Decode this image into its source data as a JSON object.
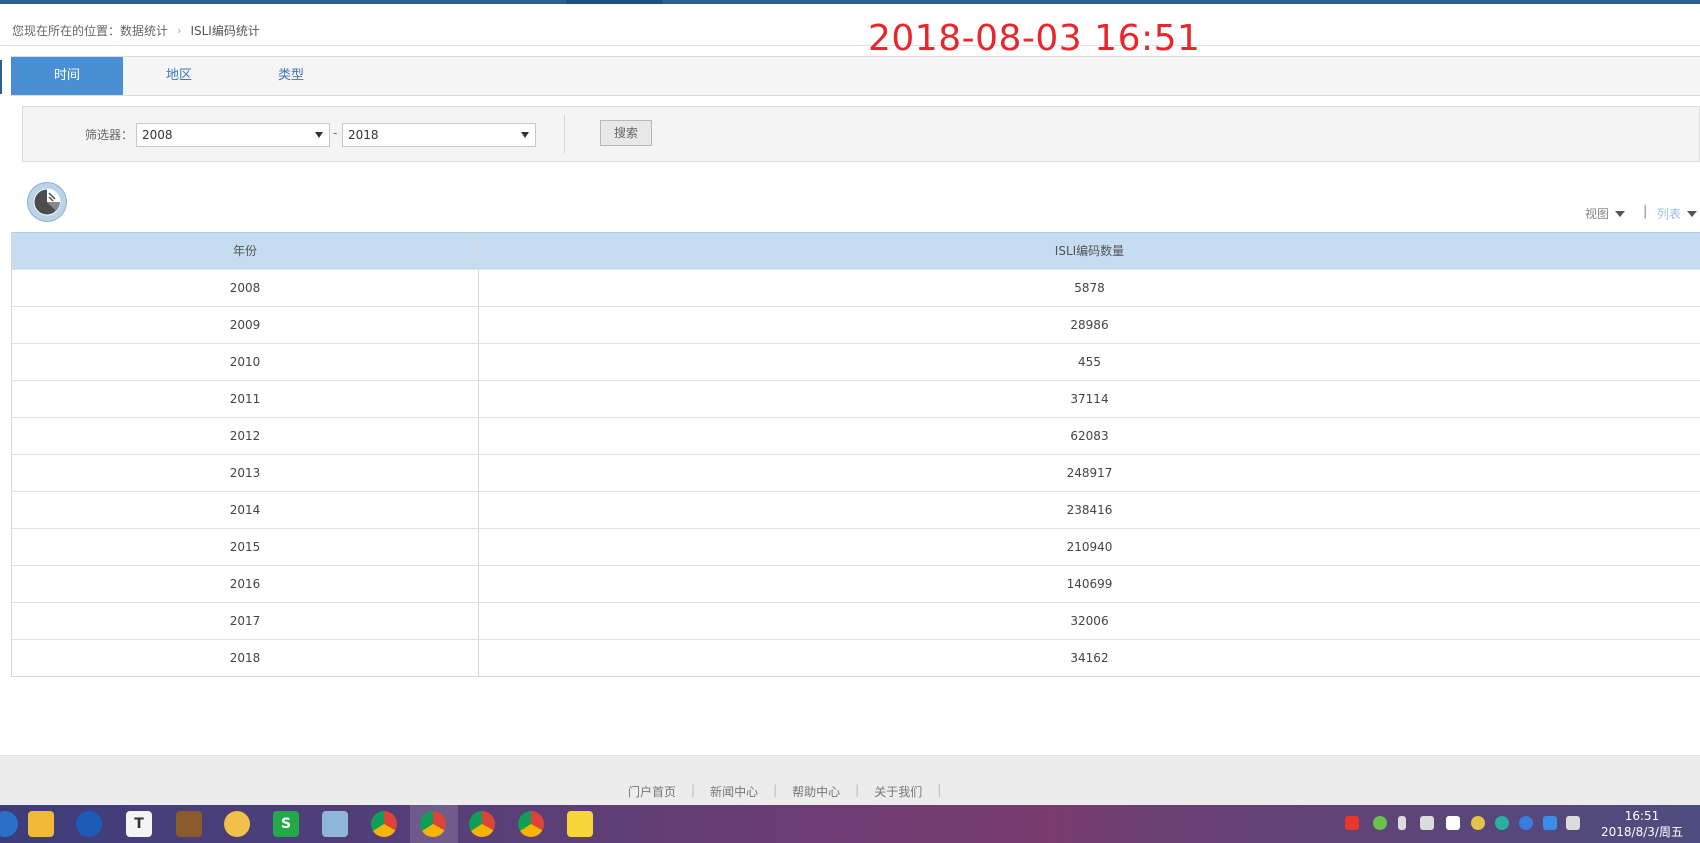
{
  "breadcrumb": {
    "prefix": "您现在所在的位置：",
    "level1": "数据统计",
    "level2": "ISLI编码统计"
  },
  "timestamp_overlay": "2018-08-03 16:51",
  "tabs": [
    {
      "label": "时间",
      "active": true
    },
    {
      "label": "地区",
      "active": false
    },
    {
      "label": "类型",
      "active": false
    }
  ],
  "filter": {
    "label": "筛选器：",
    "from_value": "2008",
    "dash": "-",
    "to_value": "2018",
    "search_label": "搜索"
  },
  "view_controls": {
    "view_label": "视图",
    "separator": "|",
    "list_label": "列表"
  },
  "table": {
    "headers": [
      "年份",
      "ISLI编码数量"
    ],
    "rows": [
      [
        "2008",
        "5878"
      ],
      [
        "2009",
        "28986"
      ],
      [
        "2010",
        "455"
      ],
      [
        "2011",
        "37114"
      ],
      [
        "2012",
        "62083"
      ],
      [
        "2013",
        "248917"
      ],
      [
        "2014",
        "238416"
      ],
      [
        "2015",
        "210940"
      ],
      [
        "2016",
        "140699"
      ],
      [
        "2017",
        "32006"
      ],
      [
        "2018",
        "34162"
      ]
    ]
  },
  "footer": {
    "links": [
      "门户首页",
      "新闻中心",
      "帮助中心",
      "关于我们"
    ],
    "separator": "|"
  },
  "taskbar": {
    "icons": [
      "cortana-icon",
      "file-explorer-icon",
      "browser-icon",
      "typora-icon",
      "game-icon",
      "chat-icon",
      "wps-spreadsheet-icon",
      "notepad-icon",
      "chrome-icon",
      "chrome-icon",
      "chrome-icon",
      "chrome-icon",
      "notes-icon"
    ],
    "clock_time": "16:51",
    "clock_date": "2018/8/3/周五"
  },
  "colors": {
    "accent": "#4a8fd3",
    "table_header": "#c5dcf1",
    "stamp": "#e8262b"
  }
}
